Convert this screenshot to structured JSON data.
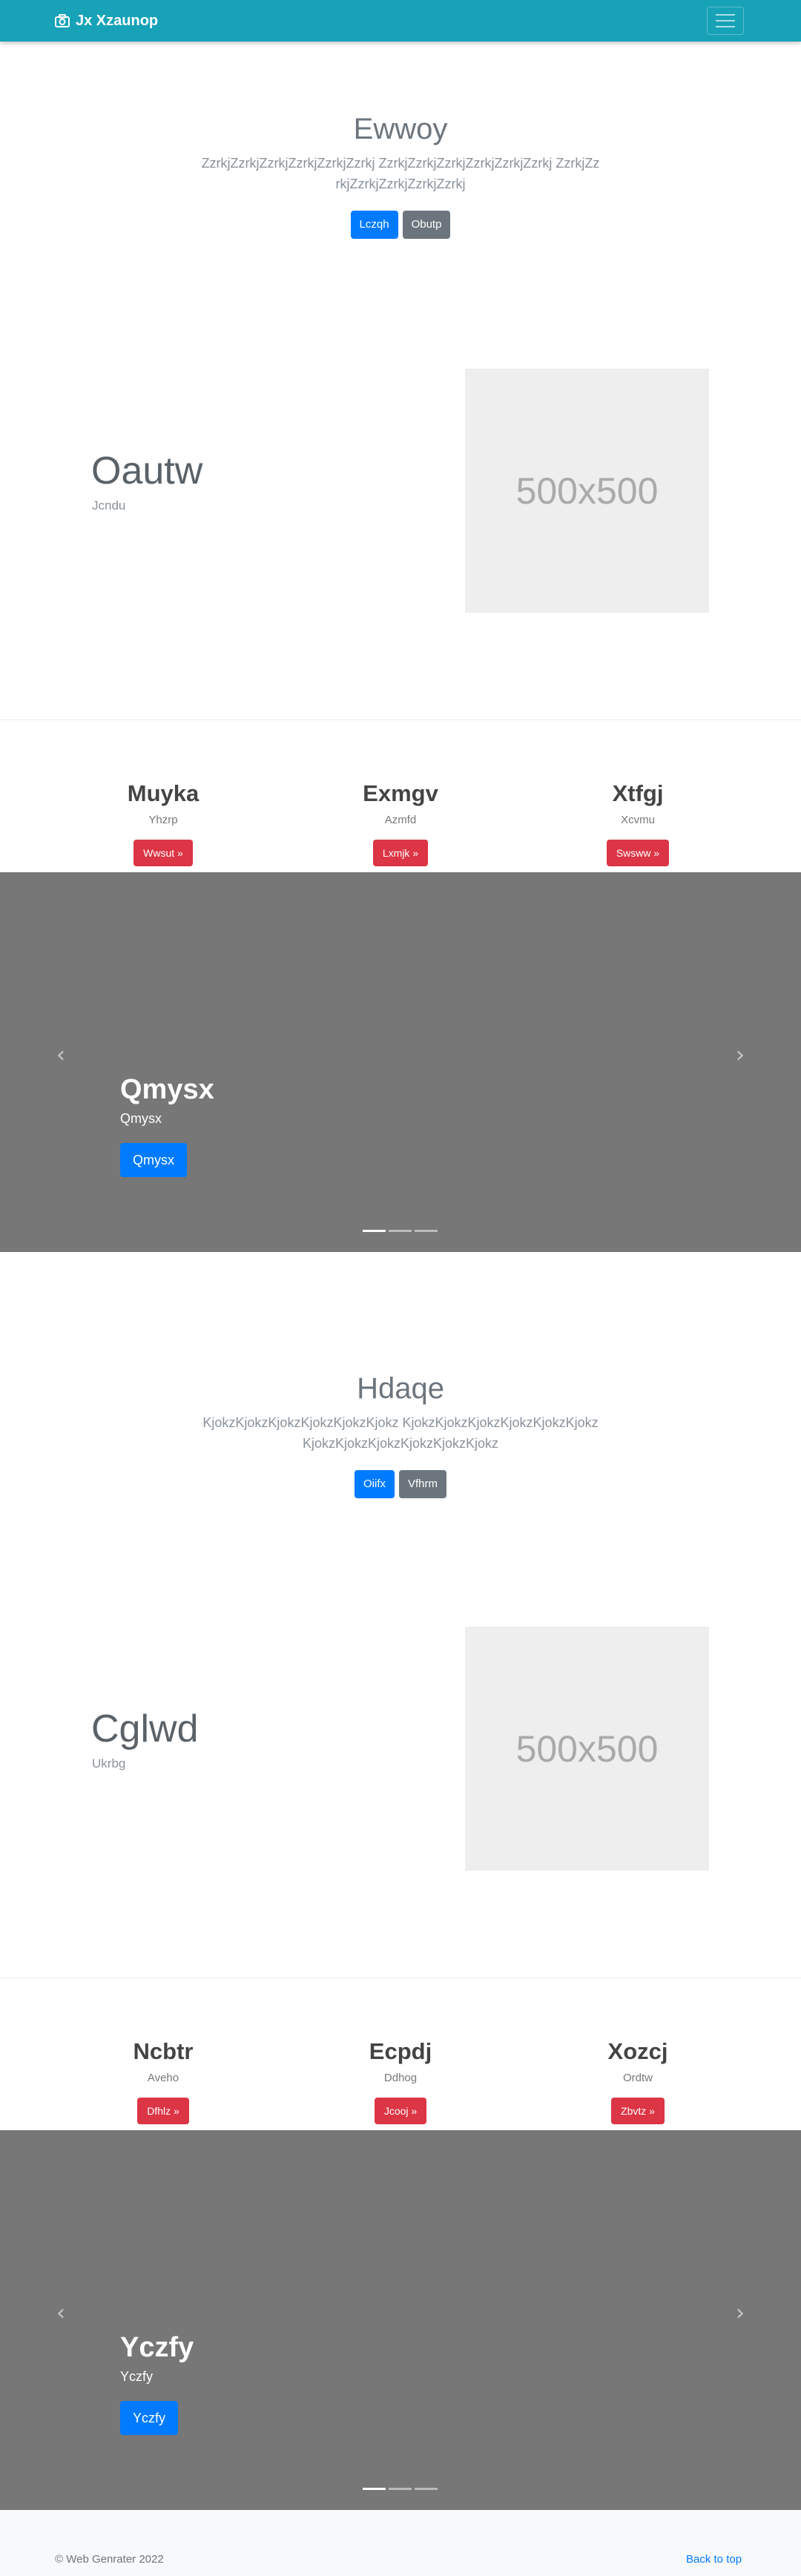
{
  "navbar": {
    "brand": "Jx Xzaunop"
  },
  "sections": [
    {
      "jumbotron": {
        "title": "Ewwoy",
        "text": "ZzrkjZzrkjZzrkjZzrkjZzrkjZzrkj ZzrkjZzrkjZzrkjZzrkjZzrkjZzrkj ZzrkjZzrkjZzrkjZzrkjZzrkjZzrkj",
        "primary": "Lczqh",
        "secondary": "Obutp"
      },
      "feature": {
        "title": "Oautw",
        "subtitle": "Jcndu",
        "image_text": "500x500"
      },
      "columns": [
        {
          "title": "Muyka",
          "desc": "Yhzrp",
          "button": "Wwsut »"
        },
        {
          "title": "Exmgv",
          "desc": "Azmfd",
          "button": "Lxmjk »"
        },
        {
          "title": "Xtfgj",
          "desc": "Xcvmu",
          "button": "Swsww »"
        }
      ],
      "carousel": {
        "title": "Qmysx",
        "text": "Qmysx",
        "button": "Qmysx"
      }
    },
    {
      "jumbotron": {
        "title": "Hdaqe",
        "text": "KjokzKjokzKjokzKjokzKjokzKjokz KjokzKjokzKjokzKjokzKjokzKjokz KjokzKjokzKjokzKjokzKjokzKjokz",
        "primary": "Oiifx",
        "secondary": "Vfhrm"
      },
      "feature": {
        "title": "Cglwd",
        "subtitle": "Ukrbg",
        "image_text": "500x500"
      },
      "columns": [
        {
          "title": "Ncbtr",
          "desc": "Aveho",
          "button": "Dfhlz »"
        },
        {
          "title": "Ecpdj",
          "desc": "Ddhog",
          "button": "Jcooj »"
        },
        {
          "title": "Xozcj",
          "desc": "Ordtw",
          "button": "Zbvtz »"
        }
      ],
      "carousel": {
        "title": "Yczfy",
        "text": "Yczfy",
        "button": "Yczfy"
      }
    }
  ],
  "carousel_controls": {
    "prev": "‹",
    "next": "›"
  },
  "footer": {
    "copyright": "© Web Genrater 2022",
    "back_to_top": "Back to top"
  }
}
